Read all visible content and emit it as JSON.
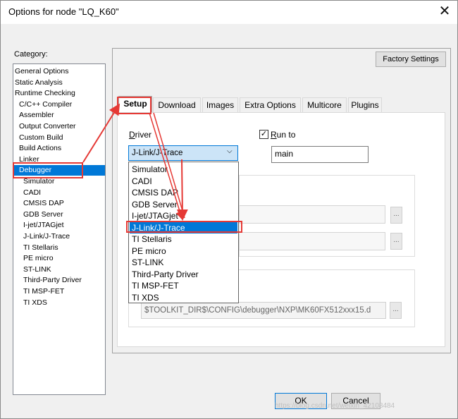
{
  "window": {
    "title": "Options for node \"LQ_K60\""
  },
  "category": {
    "label": "Category:",
    "items": [
      {
        "label": "General Options",
        "level": 0
      },
      {
        "label": "Static Analysis",
        "level": 0
      },
      {
        "label": "Runtime Checking",
        "level": 0
      },
      {
        "label": "C/C++ Compiler",
        "level": 1
      },
      {
        "label": "Assembler",
        "level": 1
      },
      {
        "label": "Output Converter",
        "level": 1
      },
      {
        "label": "Custom Build",
        "level": 1
      },
      {
        "label": "Build Actions",
        "level": 1
      },
      {
        "label": "Linker",
        "level": 1
      },
      {
        "label": "Debugger",
        "level": 1,
        "selected": true
      },
      {
        "label": "Simulator",
        "level": 2
      },
      {
        "label": "CADI",
        "level": 2
      },
      {
        "label": "CMSIS DAP",
        "level": 2
      },
      {
        "label": "GDB Server",
        "level": 2
      },
      {
        "label": "I-jet/JTAGjet",
        "level": 2
      },
      {
        "label": "J-Link/J-Trace",
        "level": 2
      },
      {
        "label": "TI Stellaris",
        "level": 2
      },
      {
        "label": "PE micro",
        "level": 2
      },
      {
        "label": "ST-LINK",
        "level": 2
      },
      {
        "label": "Third-Party Driver",
        "level": 2
      },
      {
        "label": "TI MSP-FET",
        "level": 2
      },
      {
        "label": "TI XDS",
        "level": 2
      }
    ]
  },
  "buttons": {
    "factory_settings": "Factory Settings",
    "ok": "OK",
    "cancel": "Cancel"
  },
  "tabs": [
    "Setup",
    "Download",
    "Images",
    "Extra Options",
    "Multicore",
    "Plugins"
  ],
  "setup": {
    "driver_label": "Driver",
    "driver_value": "J-Link/J-Trace",
    "run_to_label": "Run to",
    "run_to_checked": true,
    "run_to_value": "main",
    "path_value": "$TOOLKIT_DIR$\\CONFIG\\debugger\\NXP\\MK60FX512xxx15.d",
    "ellipsis": "..."
  },
  "driver_options": [
    "Simulator",
    "CADI",
    "CMSIS DAP",
    "GDB Server",
    "I-jet/JTAGjet",
    "J-Link/J-Trace",
    "TI Stellaris",
    "PE micro",
    "ST-LINK",
    "Third-Party Driver",
    "TI MSP-FET",
    "TI XDS"
  ],
  "driver_selected_index": 5,
  "watermark": "https://blog.csdn.net/weixin_42108484",
  "colors": {
    "selection": "#0078d7",
    "annotation": "#e53935"
  },
  "icons": {
    "close": "close-icon",
    "dropdown": "chevron-down-icon",
    "check": "checkmark-icon"
  }
}
